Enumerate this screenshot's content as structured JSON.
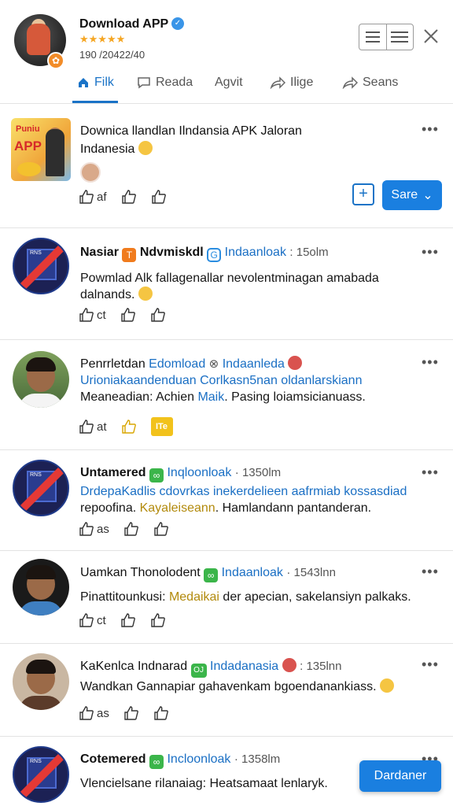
{
  "app": {
    "title": "Download APP",
    "stars": "★★★★★",
    "subtitle": "190 /20422/40"
  },
  "tabs": [
    {
      "label": "Filk",
      "active": true
    },
    {
      "label": "Reada"
    },
    {
      "label": "Agvit"
    },
    {
      "label": "Ilige"
    },
    {
      "label": "Seans"
    }
  ],
  "featured": {
    "thumb_text_top": "Puniu",
    "thumb_text_main": "APP",
    "title_line1": "Downica llandlan Ilndansia APK Jaloran",
    "title_line2": "Indanesia",
    "actions": [
      "af",
      "",
      ""
    ],
    "plus_label": "+",
    "share_label": "Sare",
    "share_chevron": "⌄"
  },
  "posts": [
    {
      "name": "Nasiar",
      "chip1": "T",
      "name2": "Ndvmiskdl",
      "chip2": "G",
      "source": "Indaanloak",
      "time": ": 15olm",
      "body": "Powmlad Alk  fallagenallar nevolentminagan amabada dalnands.",
      "action_count": "ct"
    },
    {
      "name": "Penrrletdan",
      "blue1": "Edomload",
      "source": "Indaanleda",
      "body_line1": "Urioniakaandenduan Corlkasn5nan oldanlarskiann",
      "body_line2_a": "Meaneadian: Achien ",
      "body_line2_b": "Maik",
      "body_line2_c": ". Pasing loiamsicianuass.",
      "action_count": "at",
      "badge": "ITe"
    },
    {
      "name": "Untamered",
      "source": "Inqloonloak",
      "time": "· 1350lm",
      "body_line1": "DrdepaKadlis cdovrkas inekerdelieen aafrmiab kossasdiad",
      "body_line2_a": "repoofina. ",
      "body_line2_b": "Kayaleiseann",
      "body_line2_c": ". Hamlandann pantanderan.",
      "action_count": "as"
    },
    {
      "name": "Uamkan Thonolodent",
      "source": "Indaanloak",
      "time": "· 1543lnn",
      "body_a": "Pinattitounkusi: ",
      "body_b": "Medaikai",
      "body_c": " der apecian, sakelansiyn palkaks.",
      "action_count": "ct"
    },
    {
      "name": "KaKenlca Indnarad",
      "chip": "OJ",
      "source": "Indadanasia",
      "time": ": 135lnn",
      "body": "Wandkan Gannapiar gahavenkam bgoendanankiass.",
      "action_count": "as"
    },
    {
      "name": "Cotemered",
      "source": "Incloonloak",
      "time": "· 1358lm",
      "body": "Vlencielsane rilanaiag: Heatsamaat lenlaryk.",
      "float_label": "Dardaner"
    }
  ],
  "colors": {
    "accent": "#1a73c7",
    "button": "#1a7fe0",
    "star": "#f5a623"
  }
}
